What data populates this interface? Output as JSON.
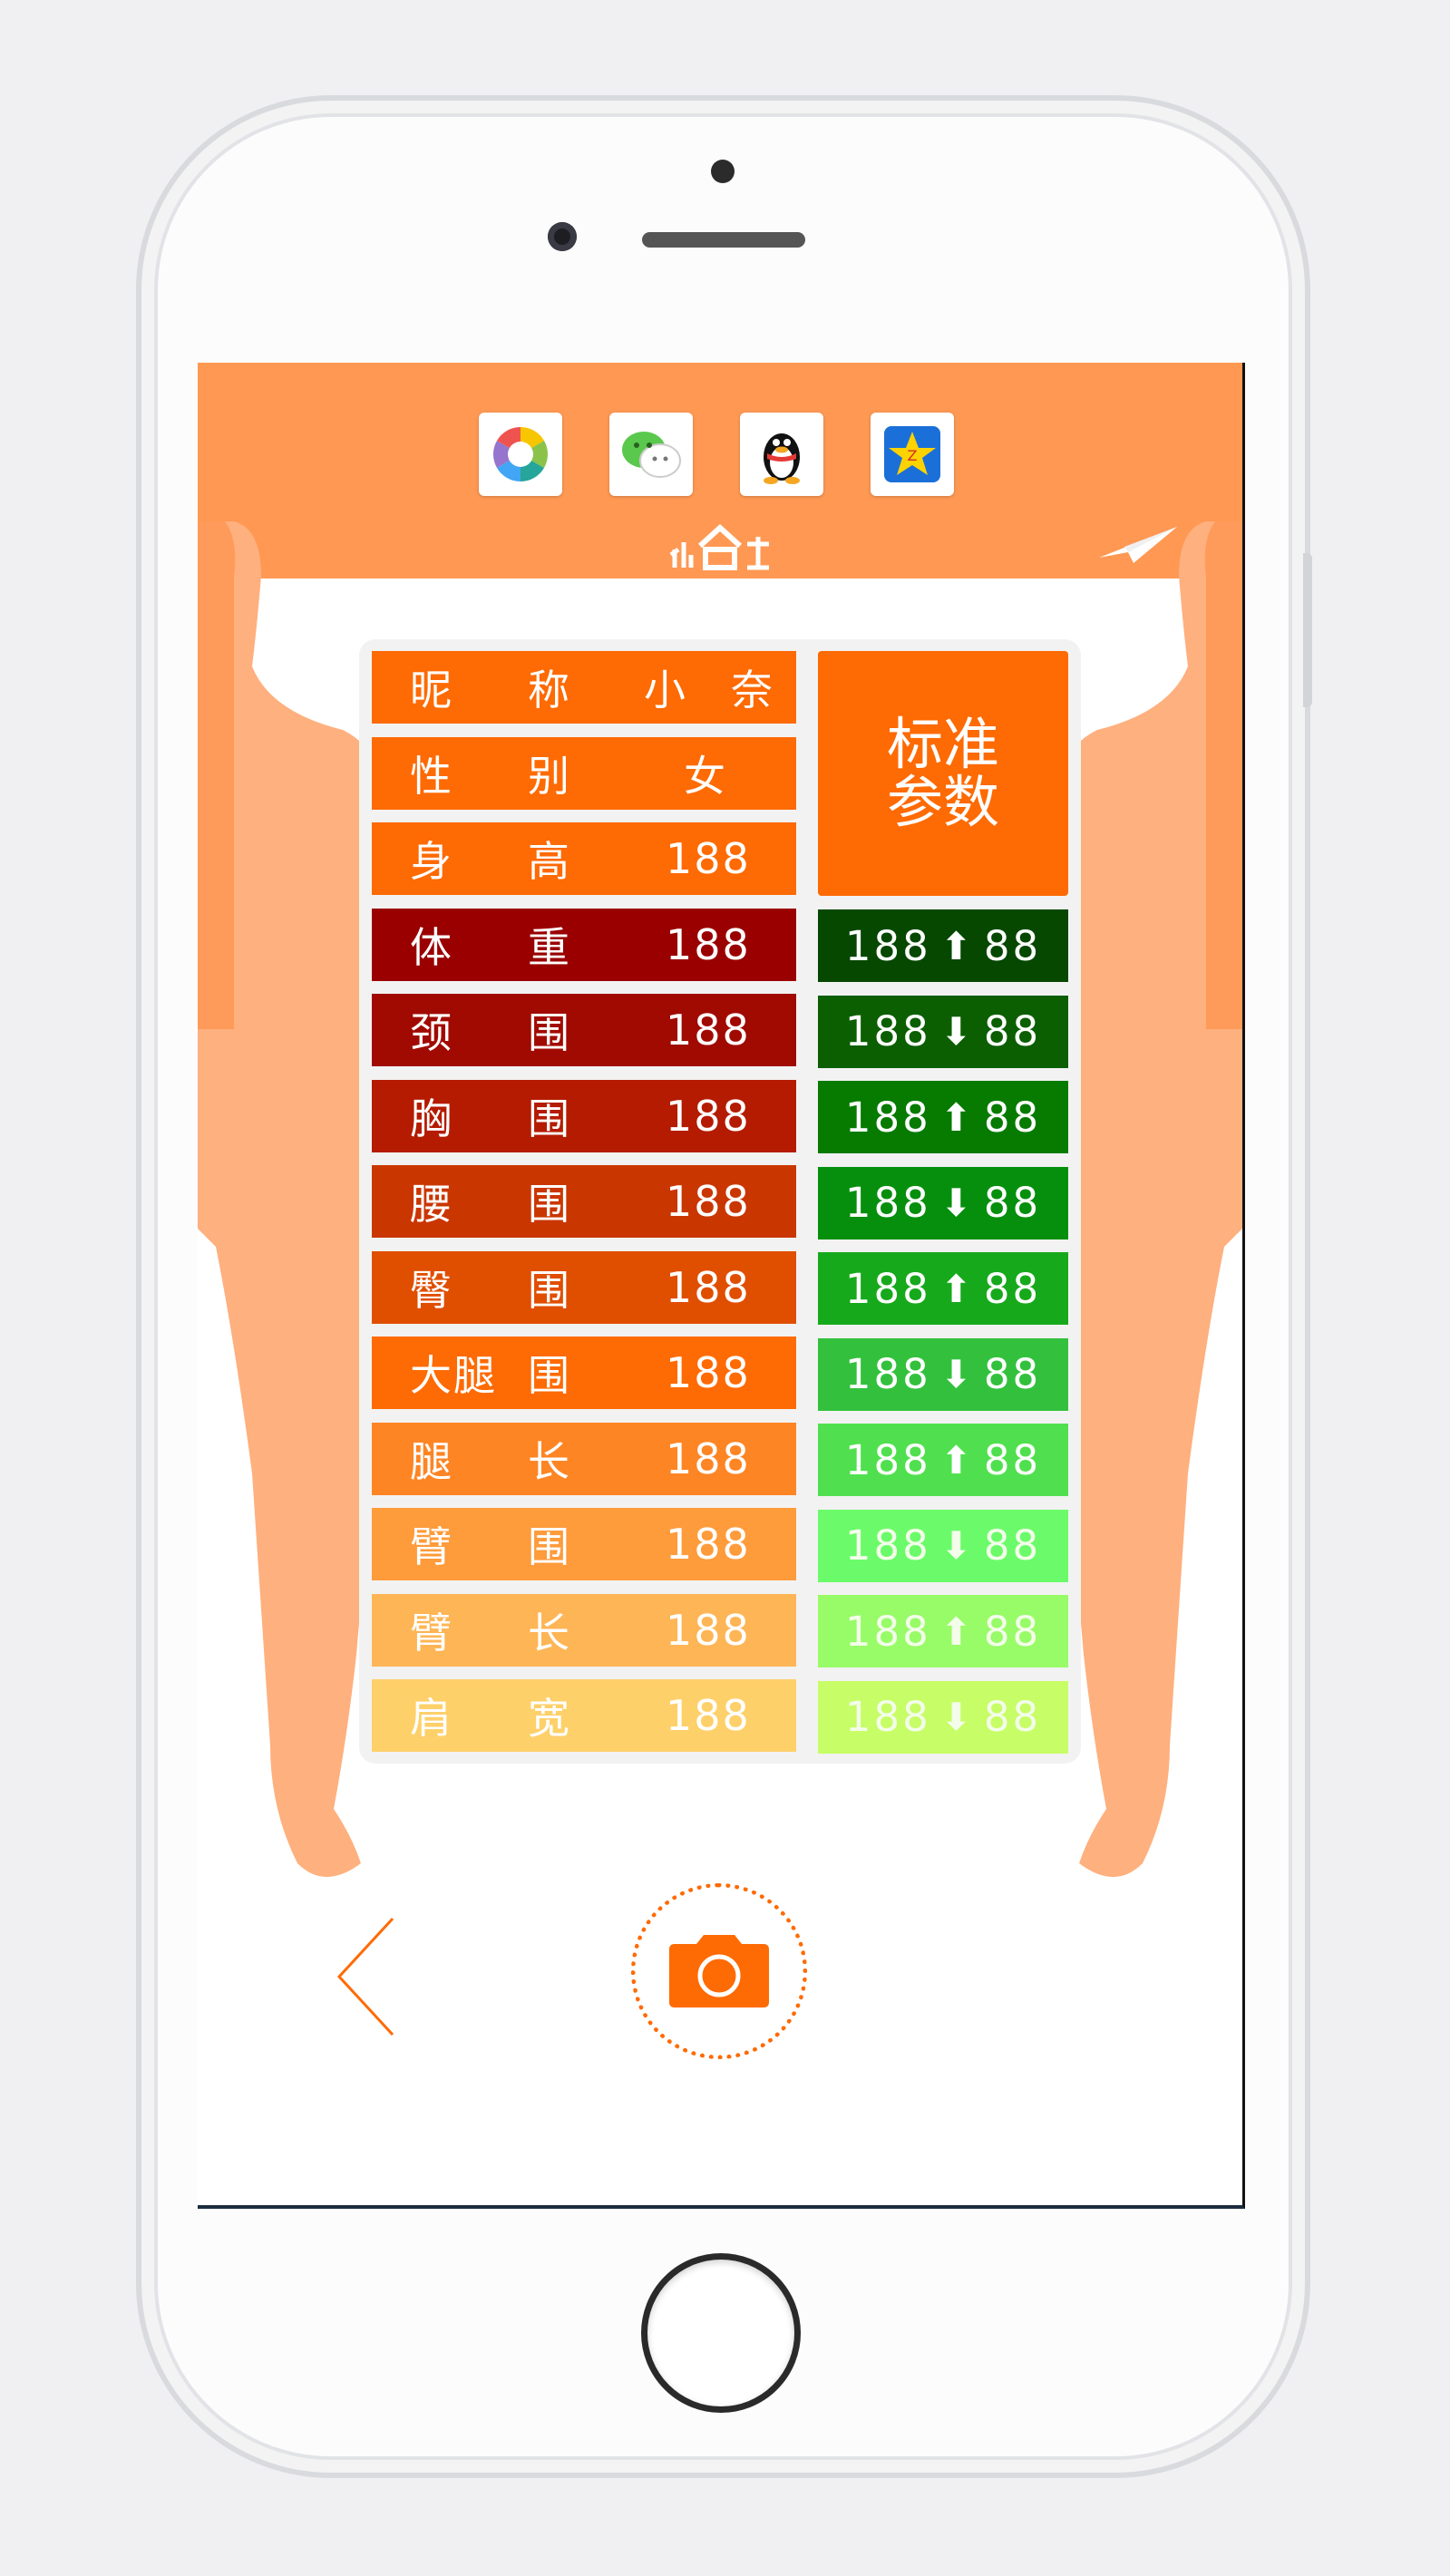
{
  "colors": {
    "header": "#fe9853",
    "accent": "#fe6a03",
    "body_skin": "#feb07e"
  },
  "share": {
    "icons": [
      "camera-aperture-icon",
      "wechat-icon",
      "qq-penguin-icon",
      "qzone-star-icon"
    ]
  },
  "header": {
    "logo_icon": "logo-icon",
    "send_icon": "paper-plane-icon"
  },
  "profile": {
    "rows": [
      {
        "l1": "昵",
        "l2": "称",
        "val": "小　奈",
        "color": "#fe6a03"
      },
      {
        "l1": "性",
        "l2": "别",
        "val": "女",
        "color": "#fe6a03"
      },
      {
        "l1": "身",
        "l2": "高",
        "val": "188",
        "color": "#fe6a03"
      }
    ]
  },
  "measures": {
    "rows": [
      {
        "l1": "体",
        "l2": "重",
        "val": "188",
        "color": "#9a0000"
      },
      {
        "l1": "颈",
        "l2": "围",
        "val": "188",
        "color": "#a10a00"
      },
      {
        "l1": "胸",
        "l2": "围",
        "val": "188",
        "color": "#b41b00"
      },
      {
        "l1": "腰",
        "l2": "围",
        "val": "188",
        "color": "#ca3600"
      },
      {
        "l1": "臀",
        "l2": "围",
        "val": "188",
        "color": "#e04e00"
      },
      {
        "l1": "大腿",
        "l2": "围",
        "val": "188",
        "color": "#fe6a03"
      },
      {
        "l1": "腿",
        "l2": "长",
        "val": "188",
        "color": "#fe8524"
      },
      {
        "l1": "臂",
        "l2": "围",
        "val": "188",
        "color": "#fe9b3b"
      },
      {
        "l1": "臂",
        "l2": "长",
        "val": "188",
        "color": "#feb555"
      },
      {
        "l1": "肩",
        "l2": "宽",
        "val": "188",
        "color": "#fed06a"
      }
    ]
  },
  "standard": {
    "title_line1": "标准",
    "title_line2": "参数",
    "rows": [
      {
        "a": "188",
        "dir": "up",
        "b": "88",
        "color": "#064800"
      },
      {
        "a": "188",
        "dir": "down",
        "b": "88",
        "color": "#0b5f00"
      },
      {
        "a": "188",
        "dir": "up",
        "b": "88",
        "color": "#067b00"
      },
      {
        "a": "188",
        "dir": "down",
        "b": "88",
        "color": "#058f0d"
      },
      {
        "a": "188",
        "dir": "up",
        "b": "88",
        "color": "#17a91c"
      },
      {
        "a": "188",
        "dir": "down",
        "b": "88",
        "color": "#33c13d"
      },
      {
        "a": "188",
        "dir": "up",
        "b": "88",
        "color": "#50e04f"
      },
      {
        "a": "188",
        "dir": "down",
        "b": "88",
        "color": "#6bfb6a"
      },
      {
        "a": "188",
        "dir": "up",
        "b": "88",
        "color": "#98fb68"
      },
      {
        "a": "188",
        "dir": "down",
        "b": "88",
        "color": "#c7fd66"
      }
    ]
  },
  "footer": {
    "back_icon": "chevron-left-icon",
    "camera_icon": "camera-icon"
  }
}
